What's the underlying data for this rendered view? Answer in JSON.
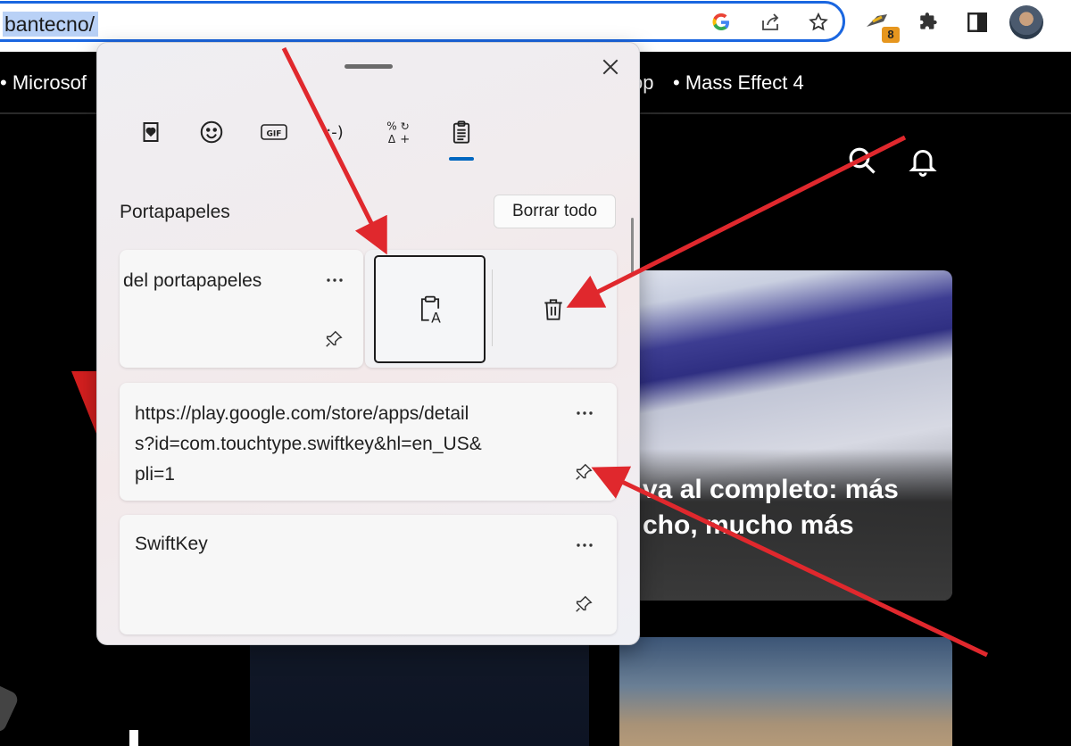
{
  "browser": {
    "url": "bantecno/",
    "icons": [
      "google-g-icon",
      "share-icon",
      "star-icon",
      "extension-icon",
      "puzzle-icon",
      "side-panel-icon"
    ],
    "extension_badge": "8"
  },
  "bookmarks": [
    "• Microsof",
    "op",
    "• Mass Effect 4"
  ],
  "clipboard_panel": {
    "tabs": [
      "favorites-icon",
      "emoji-icon",
      "gif-icon",
      "kaomoji-icon",
      "symbols-icon",
      "clipboard-icon"
    ],
    "active_tab": "clipboard-icon",
    "section_title": "Portapapeles",
    "clear_all_label": "Borrar todo",
    "items": [
      {
        "text": "del portapapeles",
        "more": "···"
      },
      {
        "text": "https://play.google.com/store/apps/details?id=com.touchtype.swiftkey&hl=en_US&pli=1",
        "more": "···"
      },
      {
        "text": "SwiftKey",
        "more": "···"
      }
    ],
    "url_lines": [
      "https://play.google.com/store/apps/detail",
      "s?id=com.touchtype.swiftkey&hl=en_US&",
      "pli=1"
    ]
  },
  "site": {
    "hero_title_lines": [
      "va al completo: más",
      "cho, mucho más"
    ]
  },
  "colors": {
    "accent": "#0067c0",
    "url_focus": "#1a66e0",
    "arrow": "#e0282d",
    "page_bg": "#000000"
  }
}
